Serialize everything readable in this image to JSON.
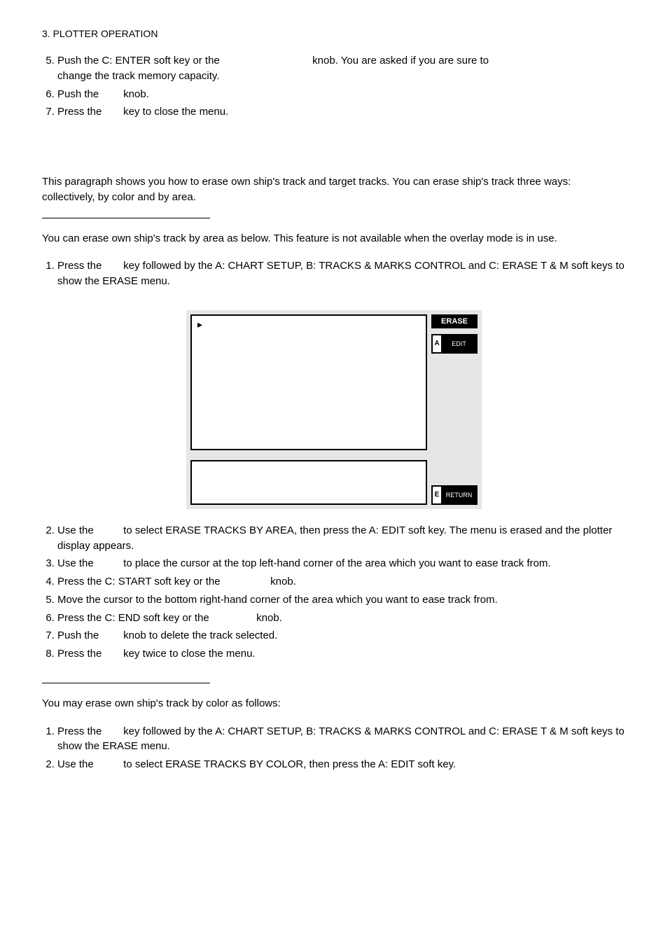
{
  "header": "3. PLOTTER OPERATION",
  "list1": {
    "i5a": "Push the C: ENTER soft key or the",
    "i5b": "knob. You are asked if you are sure to",
    "i5c": "change the track memory capacity.",
    "i6a": "Push the",
    "i6b": "knob.",
    "i7a": "Press the",
    "i7b": "key to close the menu."
  },
  "para1": "This paragraph shows you how to erase own ship's track and target tracks. You can erase ship's track three ways: collectively, by color and by area.",
  "para2": "You can erase own ship's track by area as below. This feature is not available when the overlay mode is in use.",
  "list2": {
    "i1a": "Press the",
    "i1b": "key followed by the A: CHART SETUP, B: TRACKS & MARKS CONTROL and C: ERASE T & M soft keys to show the ERASE menu."
  },
  "panel": {
    "title": "ERASE",
    "btnA_letter": "A",
    "btnA_text": "EDIT",
    "btnE_letter": "E",
    "btnE_text": "RETURN",
    "play": "▸"
  },
  "list3": {
    "i2a": "Use the",
    "i2b": "to select ERASE TRACKS BY AREA, then press the A: EDIT soft key. The menu is erased and the plotter display appears.",
    "i3a": "Use the",
    "i3b": "to place the cursor at the top left-hand corner of the area which you want to ease track from.",
    "i4a": "Press the C: START soft key or the",
    "i4b": "knob.",
    "i5": "Move the cursor to the bottom right-hand corner of the area which you want to ease track from.",
    "i6a": "Press the C: END soft key or the",
    "i6b": "knob.",
    "i7a": "Push the",
    "i7b": "knob to delete the track selected.",
    "i8a": "Press the",
    "i8b": "key twice to close the menu."
  },
  "para3": "You may erase own ship's track by color as follows:",
  "list4": {
    "i1a": "Press the",
    "i1b": "key followed by the A: CHART SETUP, B: TRACKS & MARKS CONTROL and C: ERASE T & M soft keys to show the ERASE menu.",
    "i2a": "Use the",
    "i2b": "to select ERASE TRACKS BY COLOR, then press the A: EDIT soft key."
  }
}
